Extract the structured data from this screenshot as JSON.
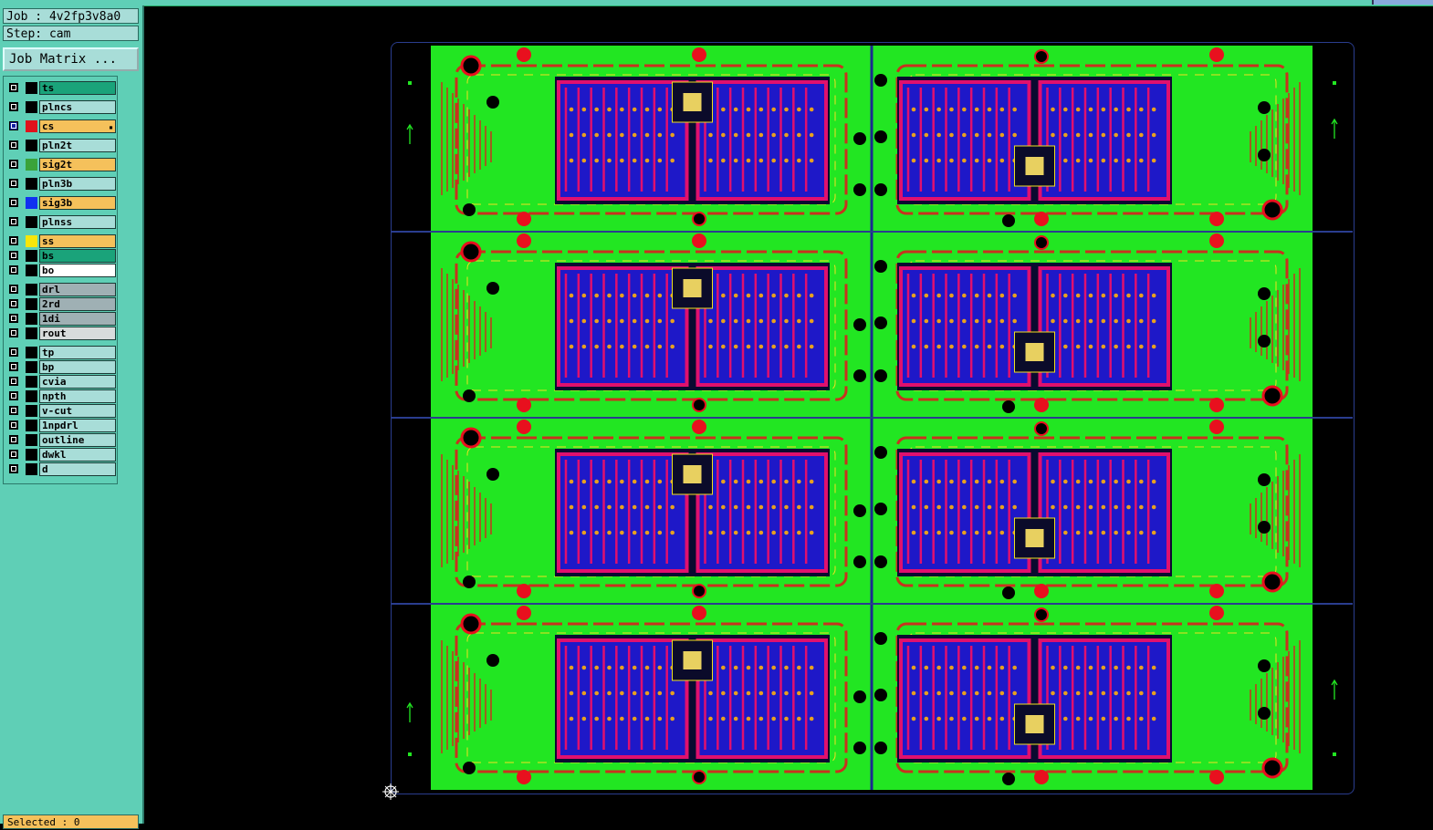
{
  "job": {
    "label": "Job : 4v2fp3v8a0"
  },
  "step": {
    "label": "Step: cam"
  },
  "job_matrix_button": "Job Matrix ...",
  "layers": [
    {
      "name": "ts",
      "bg": "#1aa37a",
      "swatch": "#000"
    },
    {
      "name": "plncs",
      "bg": "#a8ddd8",
      "swatch": "#000"
    },
    {
      "name": "cs",
      "bg": "#f5c15b",
      "swatch": "#e0121c",
      "marked": true
    },
    {
      "name": "pln2t",
      "bg": "#a8ddd8",
      "swatch": "#000"
    },
    {
      "name": "sig2t",
      "bg": "#f5c15b",
      "swatch": "#3aa33a"
    },
    {
      "name": "pln3b",
      "bg": "#a8ddd8",
      "swatch": "#000"
    },
    {
      "name": "sig3b",
      "bg": "#f5c15b",
      "swatch": "#1030f0"
    },
    {
      "name": "plnss",
      "bg": "#a8ddd8",
      "swatch": "#000"
    },
    {
      "name": "ss",
      "bg": "#f5c15b",
      "swatch": "#f7e60a"
    },
    {
      "name": "bs",
      "bg": "#1aa37a",
      "swatch": "#000"
    },
    {
      "name": "bo",
      "bg": "#ffffff",
      "swatch": "#000"
    },
    {
      "name": "drl",
      "bg": "#9fb0b4",
      "swatch": "#000"
    },
    {
      "name": "2rd",
      "bg": "#9fb0b4",
      "swatch": "#000"
    },
    {
      "name": "1di",
      "bg": "#9fb0b4",
      "swatch": "#000"
    },
    {
      "name": "rout",
      "bg": "#d8dcdc",
      "swatch": "#000"
    },
    {
      "name": "tp",
      "bg": "#a8ddd8",
      "swatch": "#000"
    },
    {
      "name": "bp",
      "bg": "#a8ddd8",
      "swatch": "#000"
    },
    {
      "name": "cvia",
      "bg": "#a8ddd8",
      "swatch": "#000"
    },
    {
      "name": "npth",
      "bg": "#a8ddd8",
      "swatch": "#000"
    },
    {
      "name": "v-cut",
      "bg": "#a8ddd8",
      "swatch": "#000"
    },
    {
      "name": "1npdrl",
      "bg": "#a8ddd8",
      "swatch": "#000"
    },
    {
      "name": "outline",
      "bg": "#a8ddd8",
      "swatch": "#000"
    },
    {
      "name": "dwkl",
      "bg": "#a8ddd8",
      "swatch": "#000"
    },
    {
      "name": "d",
      "bg": "#a8ddd8",
      "swatch": "#000"
    }
  ],
  "status": {
    "selected": "Selected : 0"
  },
  "board": {
    "rows": 4,
    "cols": 2,
    "copper": "#22e622",
    "trace": "#c8321e",
    "pad_red": "#e8101e",
    "plane_blue": "#1e18c8",
    "plane_magenta": "#e0106e",
    "silk": "#f0e020"
  }
}
